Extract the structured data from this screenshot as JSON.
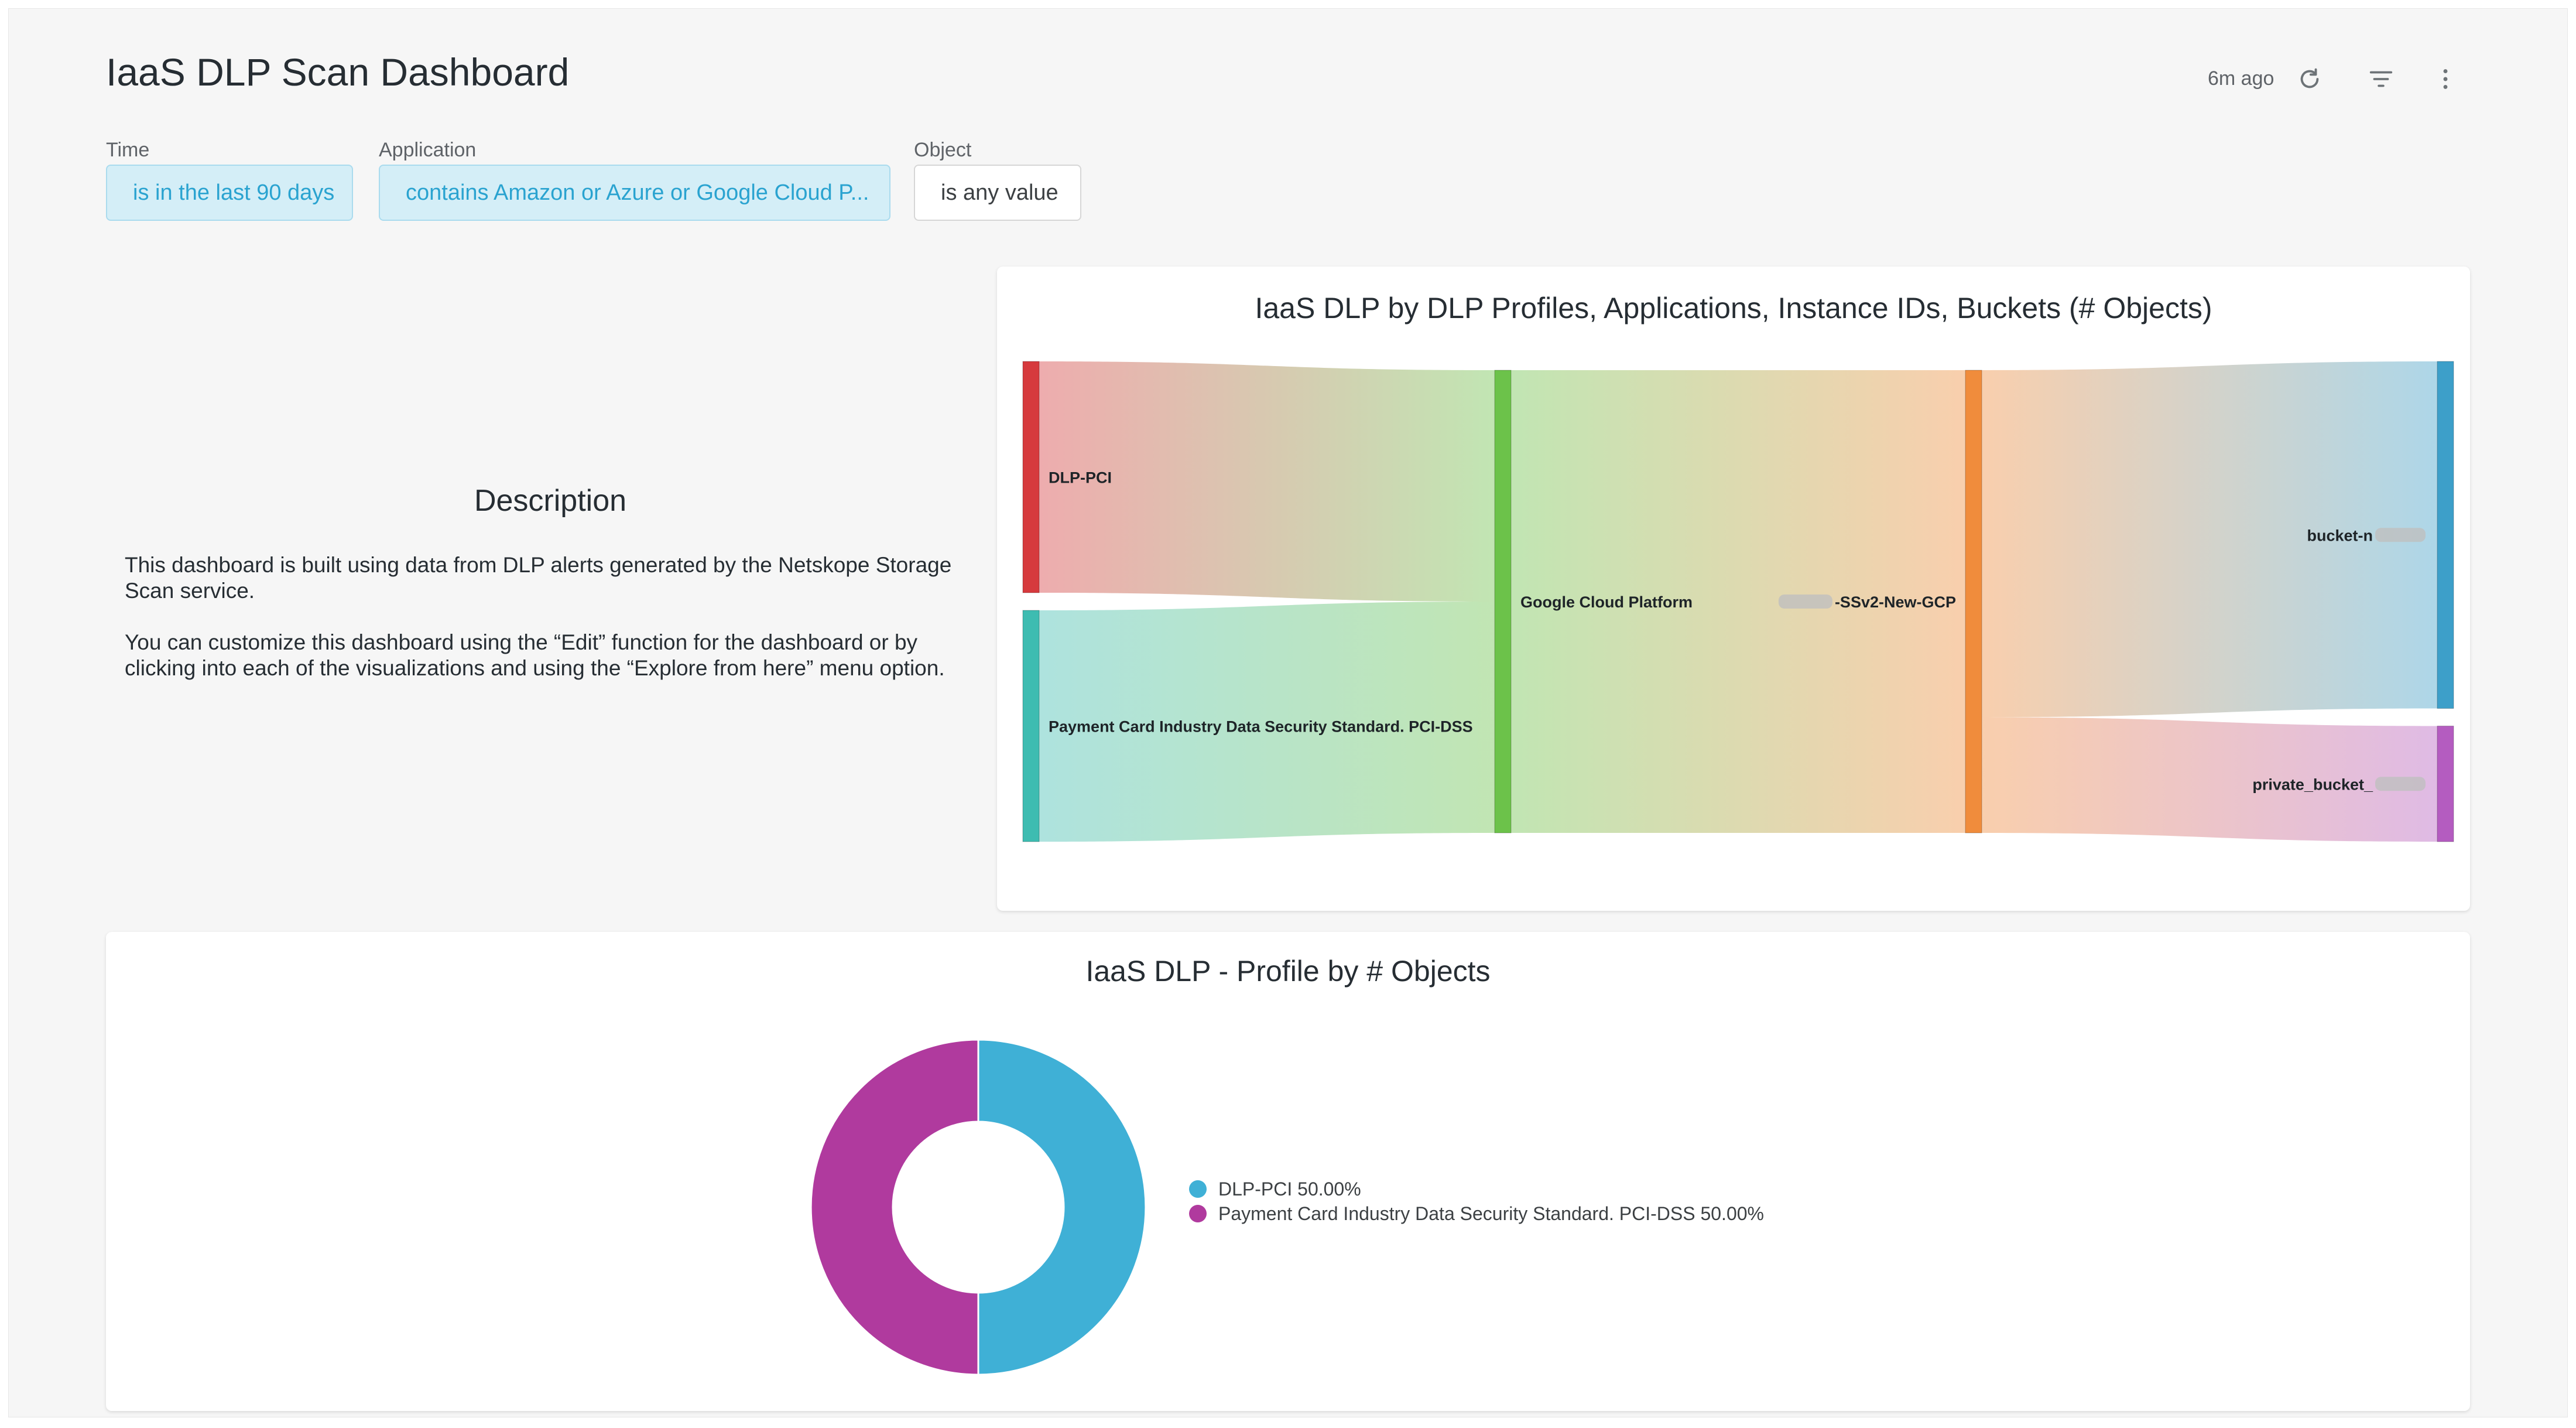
{
  "header": {
    "title": "IaaS DLP Scan Dashboard",
    "updated": "6m ago",
    "icons": [
      "refresh-icon",
      "filter-icon",
      "more-vertical-icon"
    ]
  },
  "filters": [
    {
      "label": "Time",
      "value": "is in the last 90 days",
      "active": true
    },
    {
      "label": "Application",
      "value": "contains Amazon or Azure or Google Cloud P...",
      "active": true
    },
    {
      "label": "Object",
      "value": "is any value",
      "active": false
    }
  ],
  "description": {
    "title": "Description",
    "paragraphs": [
      "This dashboard is built using data from DLP alerts generated by the Netskope Storage Scan service.",
      "You can customize this dashboard using the “Edit” function for the dashboard or by clicking into each of the visualizations and using the “Explore from here” menu option."
    ]
  },
  "chart_data": [
    {
      "type": "sankey",
      "title": "IaaS DLP by DLP Profiles, Applications, Instance IDs, Buckets (# Objects)",
      "nodes": [
        {
          "id": "dlp_pci",
          "label": "DLP-PCI",
          "column": 0,
          "color": "#d63a3d"
        },
        {
          "id": "pci_dss",
          "label": "Payment Card Industry Data Security Standard. PCI-DSS",
          "column": 0,
          "color": "#3ebcb1"
        },
        {
          "id": "gcp",
          "label": "Google Cloud Platform",
          "column": 1,
          "color": "#6cc24a"
        },
        {
          "id": "instance",
          "label": "-SSv2-New-GCP",
          "column": 2,
          "color": "#f08c3c",
          "redacted_prefix": true
        },
        {
          "id": "bucket_n",
          "label": "bucket-n",
          "column": 3,
          "color": "#3d9fc9",
          "redacted_suffix": true
        },
        {
          "id": "private_bucket",
          "label": "private_bucket_",
          "column": 3,
          "color": "#b45cc0",
          "redacted_suffix": true
        }
      ],
      "links": [
        {
          "source": "dlp_pci",
          "target": "gcp",
          "value": 50
        },
        {
          "source": "pci_dss",
          "target": "gcp",
          "value": 50
        },
        {
          "source": "gcp",
          "target": "instance",
          "value": 100
        },
        {
          "source": "instance",
          "target": "bucket_n",
          "value": 75
        },
        {
          "source": "instance",
          "target": "private_bucket",
          "value": 25
        }
      ]
    },
    {
      "type": "pie",
      "title": "IaaS DLP - Profile by # Objects",
      "donut": true,
      "legend_position": "right",
      "series": [
        {
          "name": "DLP-PCI",
          "value": 50,
          "label": "DLP-PCI 50.00%",
          "color": "#3fb0d6"
        },
        {
          "name": "Payment Card Industry Data Security Standard. PCI-DSS",
          "value": 50,
          "label": "Payment Card Industry Data Security Standard. PCI-DSS 50.00%",
          "color": "#b03a9e"
        }
      ]
    }
  ]
}
